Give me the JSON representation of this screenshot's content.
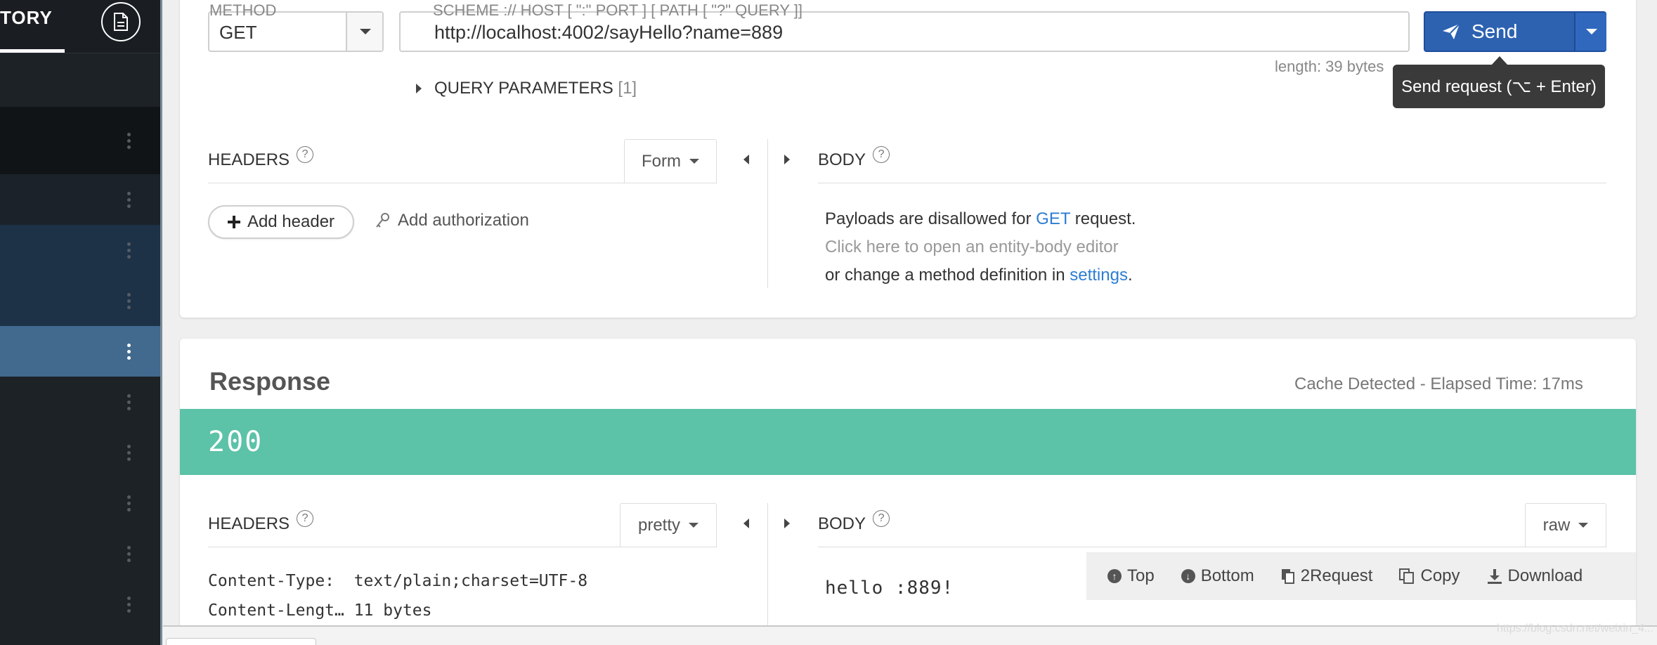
{
  "sidebar": {
    "tab_label": "TORY",
    "rows": [
      {
        "bg": "#1d2227"
      },
      {
        "bg": "#111417"
      },
      {
        "bg": "#1b2229"
      },
      {
        "bg": "#1d3247"
      },
      {
        "bg": "#1d3247"
      },
      {
        "bg": "#42698e"
      },
      {
        "bg": "#1d2227"
      },
      {
        "bg": "#1d2227"
      },
      {
        "bg": "#1d2227"
      },
      {
        "bg": "#1d2227"
      },
      {
        "bg": "#1d2227"
      }
    ]
  },
  "request": {
    "method_label": "METHOD",
    "method_value": "GET",
    "url_label": "SCHEME :// HOST [ \":\" PORT ] [ PATH [ \"?\" QUERY ]]",
    "url_value": "http://localhost:4002/sayHello?name=889",
    "send_label": "Send",
    "length_text": "length: 39 bytes",
    "tooltip_text": "Send request (⌥ + Enter)",
    "query_params_label": "QUERY PARAMETERS",
    "query_params_count": "[1]",
    "headers_label": "HEADERS",
    "headers_mode": "Form",
    "body_label": "BODY",
    "add_header_label": "Add header",
    "add_auth_label": "Add authorization",
    "payload_msg_prefix": "Payloads are disallowed for ",
    "payload_msg_method": "GET",
    "payload_msg_suffix": " request.",
    "entity_editor_msg": "Click here to open an entity-body editor",
    "change_method_prefix": "or change a method definition in ",
    "change_method_link": "settings",
    "change_method_suffix": "."
  },
  "response": {
    "title": "Response",
    "elapsed_text": "Cache Detected - Elapsed Time: 17ms",
    "status_code": "200",
    "headers_label": "HEADERS",
    "headers_mode": "pretty",
    "body_label": "BODY",
    "body_mode": "raw",
    "header_line_1": "Content-Type:  text/plain;charset=UTF-8",
    "header_line_2": "Content-Lengt… 11 bytes",
    "body_text": "hello :889!",
    "toolbar": {
      "top": "Top",
      "bottom": "Bottom",
      "to_request": "2Request",
      "copy": "Copy",
      "download": "Download"
    }
  },
  "watermark": "https://blog.csdn.net/weixin_4..."
}
